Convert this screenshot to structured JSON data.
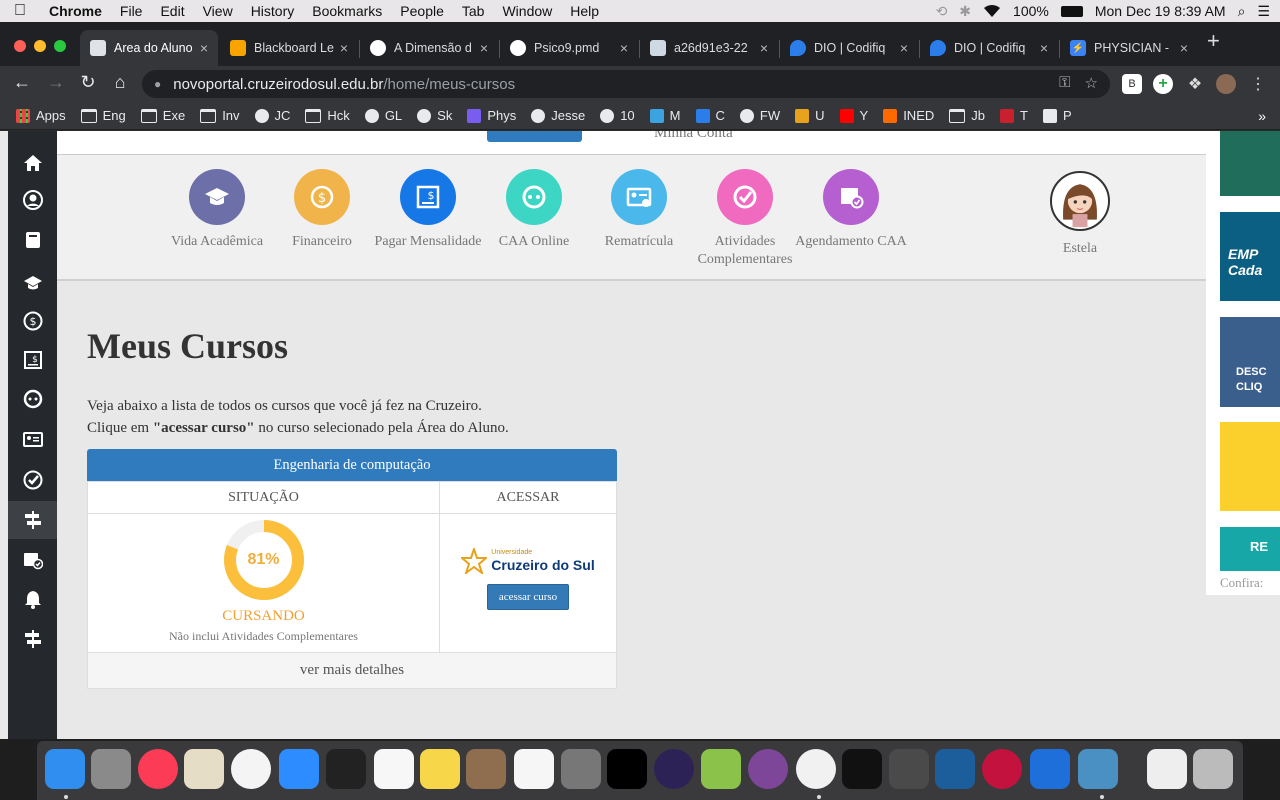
{
  "menubar": {
    "app": "Chrome",
    "items": [
      "File",
      "Edit",
      "View",
      "History",
      "Bookmarks",
      "People",
      "Tab",
      "Window",
      "Help"
    ],
    "battery": "100%",
    "datetime": "Mon Dec 19  8:39 AM"
  },
  "tabs": [
    {
      "label": "Area do Aluno",
      "active": true,
      "color": "#e0e0e0"
    },
    {
      "label": "Blackboard Le",
      "active": false,
      "color": "#f7a400"
    },
    {
      "label": "A Dimensão d",
      "active": false,
      "color": "#ffffff"
    },
    {
      "label": "Psico9.pmd",
      "active": false,
      "color": "#ffffff"
    },
    {
      "label": "a26d91e3-22",
      "active": false,
      "color": "#cfd8e3"
    },
    {
      "label": "DIO | Codifiq",
      "active": false,
      "color": "#2b7de9"
    },
    {
      "label": "DIO | Codifiq",
      "active": false,
      "color": "#2b7de9"
    },
    {
      "label": "PHYSICIAN -",
      "active": false,
      "color": "#3b82f6"
    }
  ],
  "address": {
    "host": "novoportal.cruzeirodosul.edu.br",
    "path": "/home/meus-cursos"
  },
  "bookmarks": [
    {
      "label": "Apps",
      "kind": "apps"
    },
    {
      "label": "Eng",
      "kind": "folder"
    },
    {
      "label": "Exe",
      "kind": "folder"
    },
    {
      "label": "Inv",
      "kind": "folder"
    },
    {
      "label": "JC",
      "kind": "globe"
    },
    {
      "label": "Hck",
      "kind": "folder"
    },
    {
      "label": "GL",
      "kind": "globe"
    },
    {
      "label": "Sk",
      "kind": "globe"
    },
    {
      "label": "Phys",
      "kind": "phys"
    },
    {
      "label": "Jesse",
      "kind": "globe"
    },
    {
      "label": "10",
      "kind": "globe"
    },
    {
      "label": "M",
      "kind": "m"
    },
    {
      "label": "C",
      "kind": "c"
    },
    {
      "label": "FW",
      "kind": "globe"
    },
    {
      "label": "U",
      "kind": "u"
    },
    {
      "label": "Y",
      "kind": "yt"
    },
    {
      "label": "INED",
      "kind": "ined"
    },
    {
      "label": "Jb",
      "kind": "folder"
    },
    {
      "label": "T",
      "kind": "t"
    },
    {
      "label": "P",
      "kind": "p"
    }
  ],
  "topmenu": {
    "account": "Minha Conta"
  },
  "shortcuts": [
    {
      "label": "Vida Acadêmica",
      "color": "#6c6fa8",
      "icon": "graduation-cap-icon"
    },
    {
      "label": "Financeiro",
      "color": "#f0b44a",
      "icon": "dollar-icon"
    },
    {
      "label": "Pagar Mensalidade",
      "color": "#1677e6",
      "icon": "invoice-icon"
    },
    {
      "label": "CAA Online",
      "color": "#3dd6c5",
      "icon": "headset-icon"
    },
    {
      "label": "Rematrícula",
      "color": "#4ab8ea",
      "icon": "id-card-icon"
    },
    {
      "label": "Atividades Complementares",
      "color": "#f06ac0",
      "icon": "check-circle-icon"
    },
    {
      "label": "Agendamento CAA",
      "color": "#b65fd1",
      "icon": "calendar-check-icon"
    }
  ],
  "user": {
    "name": "Estela"
  },
  "page": {
    "title": "Meus Cursos",
    "desc1": "Veja abaixo a lista de todos os cursos que você já fez na Cruzeiro.",
    "desc2_pre": "Clique em ",
    "desc2_bold": "\"acessar curso\"",
    "desc2_post": " no curso selecionado pela Área do Aluno."
  },
  "course": {
    "name": "Engenharia de computação",
    "col_status": "SITUAÇÃO",
    "col_access": "ACESSAR",
    "progress": 81,
    "progress_label": "81%",
    "status": "CURSANDO",
    "note": "Não inclui Atividades Complementares",
    "logo_top": "Universidade",
    "logo_name": "Cruzeiro do Sul",
    "access_button": "acessar curso",
    "more": "ver mais detalhes",
    "progress_color": "#fbbf3b"
  },
  "ads": {
    "a2": "EMP",
    "a2b": "Cada",
    "a3": "DESC",
    "a3b": "CLIQ",
    "a5": "RE",
    "confira": "Confira:"
  }
}
